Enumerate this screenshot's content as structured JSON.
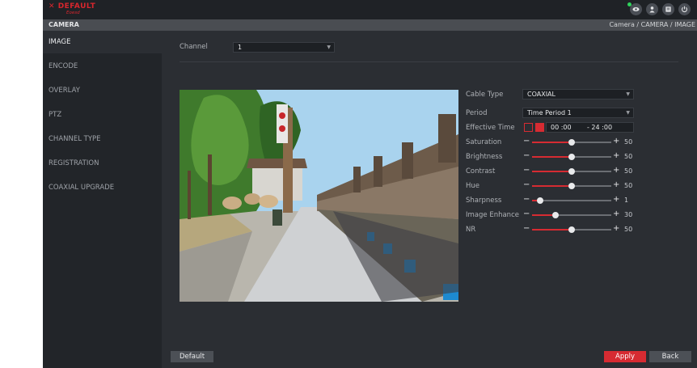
{
  "app": {
    "logo_text_red": "DEFAULT",
    "logo_text_white": "",
    "logo_subtext": "Eoesd",
    "top_icons": [
      "live-view-icon",
      "user-icon",
      "recording-icon",
      "power-icon"
    ]
  },
  "header": {
    "section": "CAMERA",
    "breadcrumb": "Camera  /  CAMERA  /  IMAGE"
  },
  "sidebar": {
    "items": [
      {
        "label": "IMAGE",
        "active": true
      },
      {
        "label": "ENCODE",
        "active": false
      },
      {
        "label": "OVERLAY",
        "active": false
      },
      {
        "label": "PTZ",
        "active": false
      },
      {
        "label": "CHANNEL TYPE",
        "active": false
      },
      {
        "label": "REGISTRATION",
        "active": false
      },
      {
        "label": "COAXIAL UPGRADE",
        "active": false
      }
    ]
  },
  "channel": {
    "label": "Channel",
    "value": "1"
  },
  "settings": {
    "cable_type": {
      "label": "Cable Type",
      "value": "COAXIAL"
    },
    "period": {
      "label": "Period",
      "value": "Time Period 1"
    },
    "effective_time": {
      "label": "Effective Time",
      "start": "00 :00",
      "end": "- 24 :00"
    }
  },
  "sliders": [
    {
      "label": "Saturation",
      "value": "50",
      "level": 0.5
    },
    {
      "label": "Brightness",
      "value": "50",
      "level": 0.5
    },
    {
      "label": "Contrast",
      "value": "50",
      "level": 0.5
    },
    {
      "label": "Hue",
      "value": "50",
      "level": 0.5
    },
    {
      "label": "Sharpness",
      "value": "1",
      "level": 0.1
    },
    {
      "label": "Image Enhance",
      "value": "30",
      "level": 0.3
    },
    {
      "label": "NR",
      "value": "50",
      "level": 0.5
    }
  ],
  "buttons": {
    "default": "Default",
    "apply": "Apply",
    "back": "Back"
  },
  "colors": {
    "accent": "#d62b32",
    "background": "#2b2e33",
    "sidebar": "#222529"
  }
}
